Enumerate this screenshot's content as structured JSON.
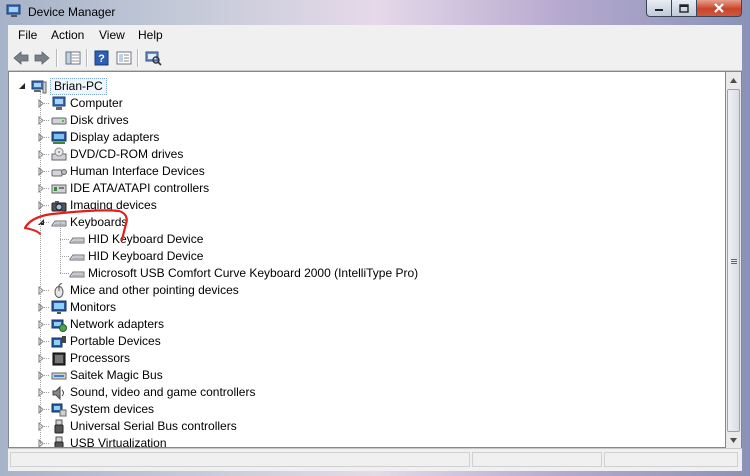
{
  "window": {
    "title": "Device Manager"
  },
  "menu": [
    "File",
    "Action",
    "View",
    "Help"
  ],
  "tree": {
    "root": "Brian-PC",
    "categories": [
      {
        "label": "Computer",
        "icon": "computer-icon"
      },
      {
        "label": "Disk drives",
        "icon": "disk-drive-icon"
      },
      {
        "label": "Display adapters",
        "icon": "display-adapter-icon"
      },
      {
        "label": "DVD/CD-ROM drives",
        "icon": "dvd-drive-icon"
      },
      {
        "label": "Human Interface Devices",
        "icon": "hid-icon"
      },
      {
        "label": "IDE ATA/ATAPI controllers",
        "icon": "ide-controller-icon"
      },
      {
        "label": "Imaging devices",
        "icon": "camera-icon"
      },
      {
        "label": "Keyboards",
        "icon": "keyboard-icon",
        "expanded": true,
        "children": [
          {
            "label": "HID Keyboard Device",
            "icon": "keyboard-icon"
          },
          {
            "label": "HID Keyboard Device",
            "icon": "keyboard-icon"
          },
          {
            "label": "Microsoft USB Comfort Curve Keyboard 2000 (IntelliType Pro)",
            "icon": "keyboard-icon"
          }
        ]
      },
      {
        "label": "Mice and other pointing devices",
        "icon": "mouse-icon"
      },
      {
        "label": "Monitors",
        "icon": "monitor-icon"
      },
      {
        "label": "Network adapters",
        "icon": "network-adapter-icon"
      },
      {
        "label": "Portable Devices",
        "icon": "portable-device-icon"
      },
      {
        "label": "Processors",
        "icon": "processor-icon"
      },
      {
        "label": "Saitek Magic Bus",
        "icon": "bus-icon"
      },
      {
        "label": "Sound, video and game controllers",
        "icon": "speaker-icon"
      },
      {
        "label": "System devices",
        "icon": "system-device-icon"
      },
      {
        "label": "Universal Serial Bus controllers",
        "icon": "usb-icon"
      },
      {
        "label": "USB Virtualization",
        "icon": "usb-icon"
      }
    ]
  },
  "colors": {
    "annotation": "#e0201c",
    "selection_border": "#7da2ce"
  }
}
